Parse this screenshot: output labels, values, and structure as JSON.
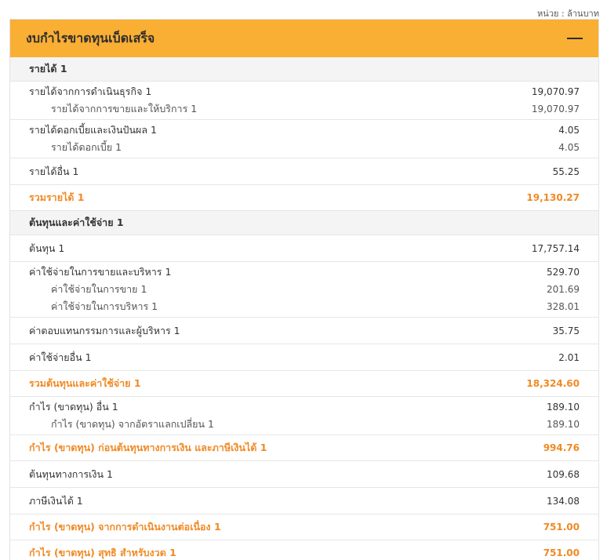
{
  "unit_label": "หน่วย : ล้านบาท",
  "panel": {
    "title": "งบกำไรขาดทุนเบ็ดเสร็จ"
  },
  "revenue": {
    "header": "รายได้ 1",
    "operating": {
      "label": "รายได้จากการดำเนินธุรกิจ 1",
      "value": "19,070.97"
    },
    "sales_services": {
      "label": "รายได้จากการขายและให้บริการ 1",
      "value": "19,070.97"
    },
    "interest_dividend": {
      "label": "รายได้ดอกเบี้ยและเงินปันผล 1",
      "value": "4.05"
    },
    "interest": {
      "label": "รายได้ดอกเบี้ย 1",
      "value": "4.05"
    },
    "other": {
      "label": "รายได้อื่น 1",
      "value": "55.25"
    },
    "total": {
      "label": "รวมรายได้ 1",
      "value": "19,130.27"
    }
  },
  "costs": {
    "header": "ต้นทุนและค่าใช้จ่าย 1",
    "cost": {
      "label": "ต้นทุน 1",
      "value": "17,757.14"
    },
    "sga": {
      "label": "ค่าใช้จ่ายในการขายและบริหาร 1",
      "value": "529.70"
    },
    "selling": {
      "label": "ค่าใช้จ่ายในการขาย 1",
      "value": "201.69"
    },
    "admin": {
      "label": "ค่าใช้จ่ายในการบริหาร 1",
      "value": "328.01"
    },
    "directors": {
      "label": "ค่าตอบแทนกรรมการและผู้บริหาร 1",
      "value": "35.75"
    },
    "other": {
      "label": "ค่าใช้จ่ายอื่น 1",
      "value": "2.01"
    },
    "total": {
      "label": "รวมต้นทุนและค่าใช้จ่าย 1",
      "value": "18,324.60"
    }
  },
  "other_gain": {
    "label": "กำไร (ขาดทุน) อื่น 1",
    "value": "189.10",
    "fx": {
      "label": "กำไร (ขาดทุน) จากอัตราแลกเปลี่ยน 1",
      "value": "189.10"
    }
  },
  "ebt": {
    "label": "กำไร (ขาดทุน) ก่อนต้นทุนทางการเงิน และภาษีเงินได้ 1",
    "value": "994.76"
  },
  "finance_cost": {
    "label": "ต้นทุนทางการเงิน 1",
    "value": "109.68"
  },
  "income_tax": {
    "label": "ภาษีเงินได้ 1",
    "value": "134.08"
  },
  "continuing": {
    "label": "กำไร (ขาดทุน) จากการดำเนินงานต่อเนื่อง 1",
    "value": "751.00"
  },
  "net": {
    "label": "กำไร (ขาดทุน) สุทธิ สำหรับงวด 1",
    "value": "751.00"
  }
}
